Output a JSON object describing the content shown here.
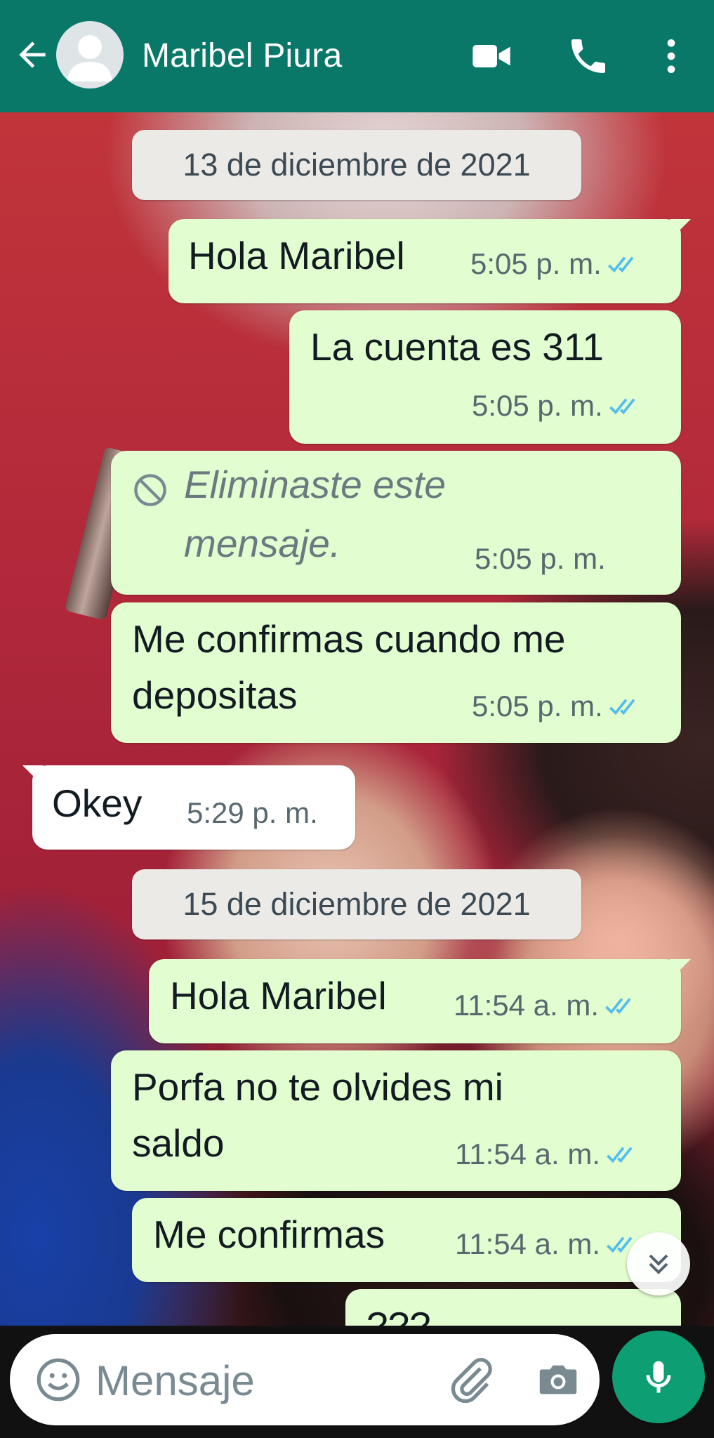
{
  "header": {
    "contact_name": "Maribel Piura",
    "back_icon": "arrow-left-icon",
    "video_icon": "video-call-icon",
    "call_icon": "phone-icon",
    "menu_icon": "more-vert-icon"
  },
  "colors": {
    "header_bg": "#097869",
    "outgoing_bubble": "#e2fdd0",
    "incoming_bubble": "#ffffff",
    "read_ticks": "#53bdeb",
    "mic_button": "#0d9e73"
  },
  "messages": [
    {
      "type": "date",
      "text": "13 de diciembre de 2021"
    },
    {
      "type": "out",
      "text": "Hola Maribel",
      "time": "5:05 p. m.",
      "status": "read"
    },
    {
      "type": "out",
      "text": "La cuenta es 311",
      "time": "5:05 p. m.",
      "status": "read"
    },
    {
      "type": "out-deleted",
      "line1": "Eliminaste este",
      "line2": "mensaje.",
      "time": "5:05 p. m."
    },
    {
      "type": "out",
      "line1": "Me confirmas cuando me",
      "line2": "depositas",
      "time": "5:05 p. m.",
      "status": "read"
    },
    {
      "type": "in",
      "text": "Okey",
      "time": "5:29 p. m."
    },
    {
      "type": "date",
      "text": "15 de diciembre de 2021"
    },
    {
      "type": "out",
      "text": "Hola Maribel",
      "time": "11:54 a. m.",
      "status": "read"
    },
    {
      "type": "out",
      "line1": "Porfa no te olvides mi",
      "line2": "saldo",
      "time": "11:54 a. m.",
      "status": "read"
    },
    {
      "type": "out",
      "text": "Me confirmas",
      "time": "11:54 a. m.",
      "status": "read"
    },
    {
      "type": "out-partial",
      "text": "???"
    }
  ],
  "composer": {
    "placeholder": "Mensaje",
    "emoji_icon": "emoji-icon",
    "attach_icon": "paperclip-icon",
    "camera_icon": "camera-icon",
    "mic_icon": "microphone-icon"
  },
  "scroll_button_icon": "double-chevron-down-icon"
}
